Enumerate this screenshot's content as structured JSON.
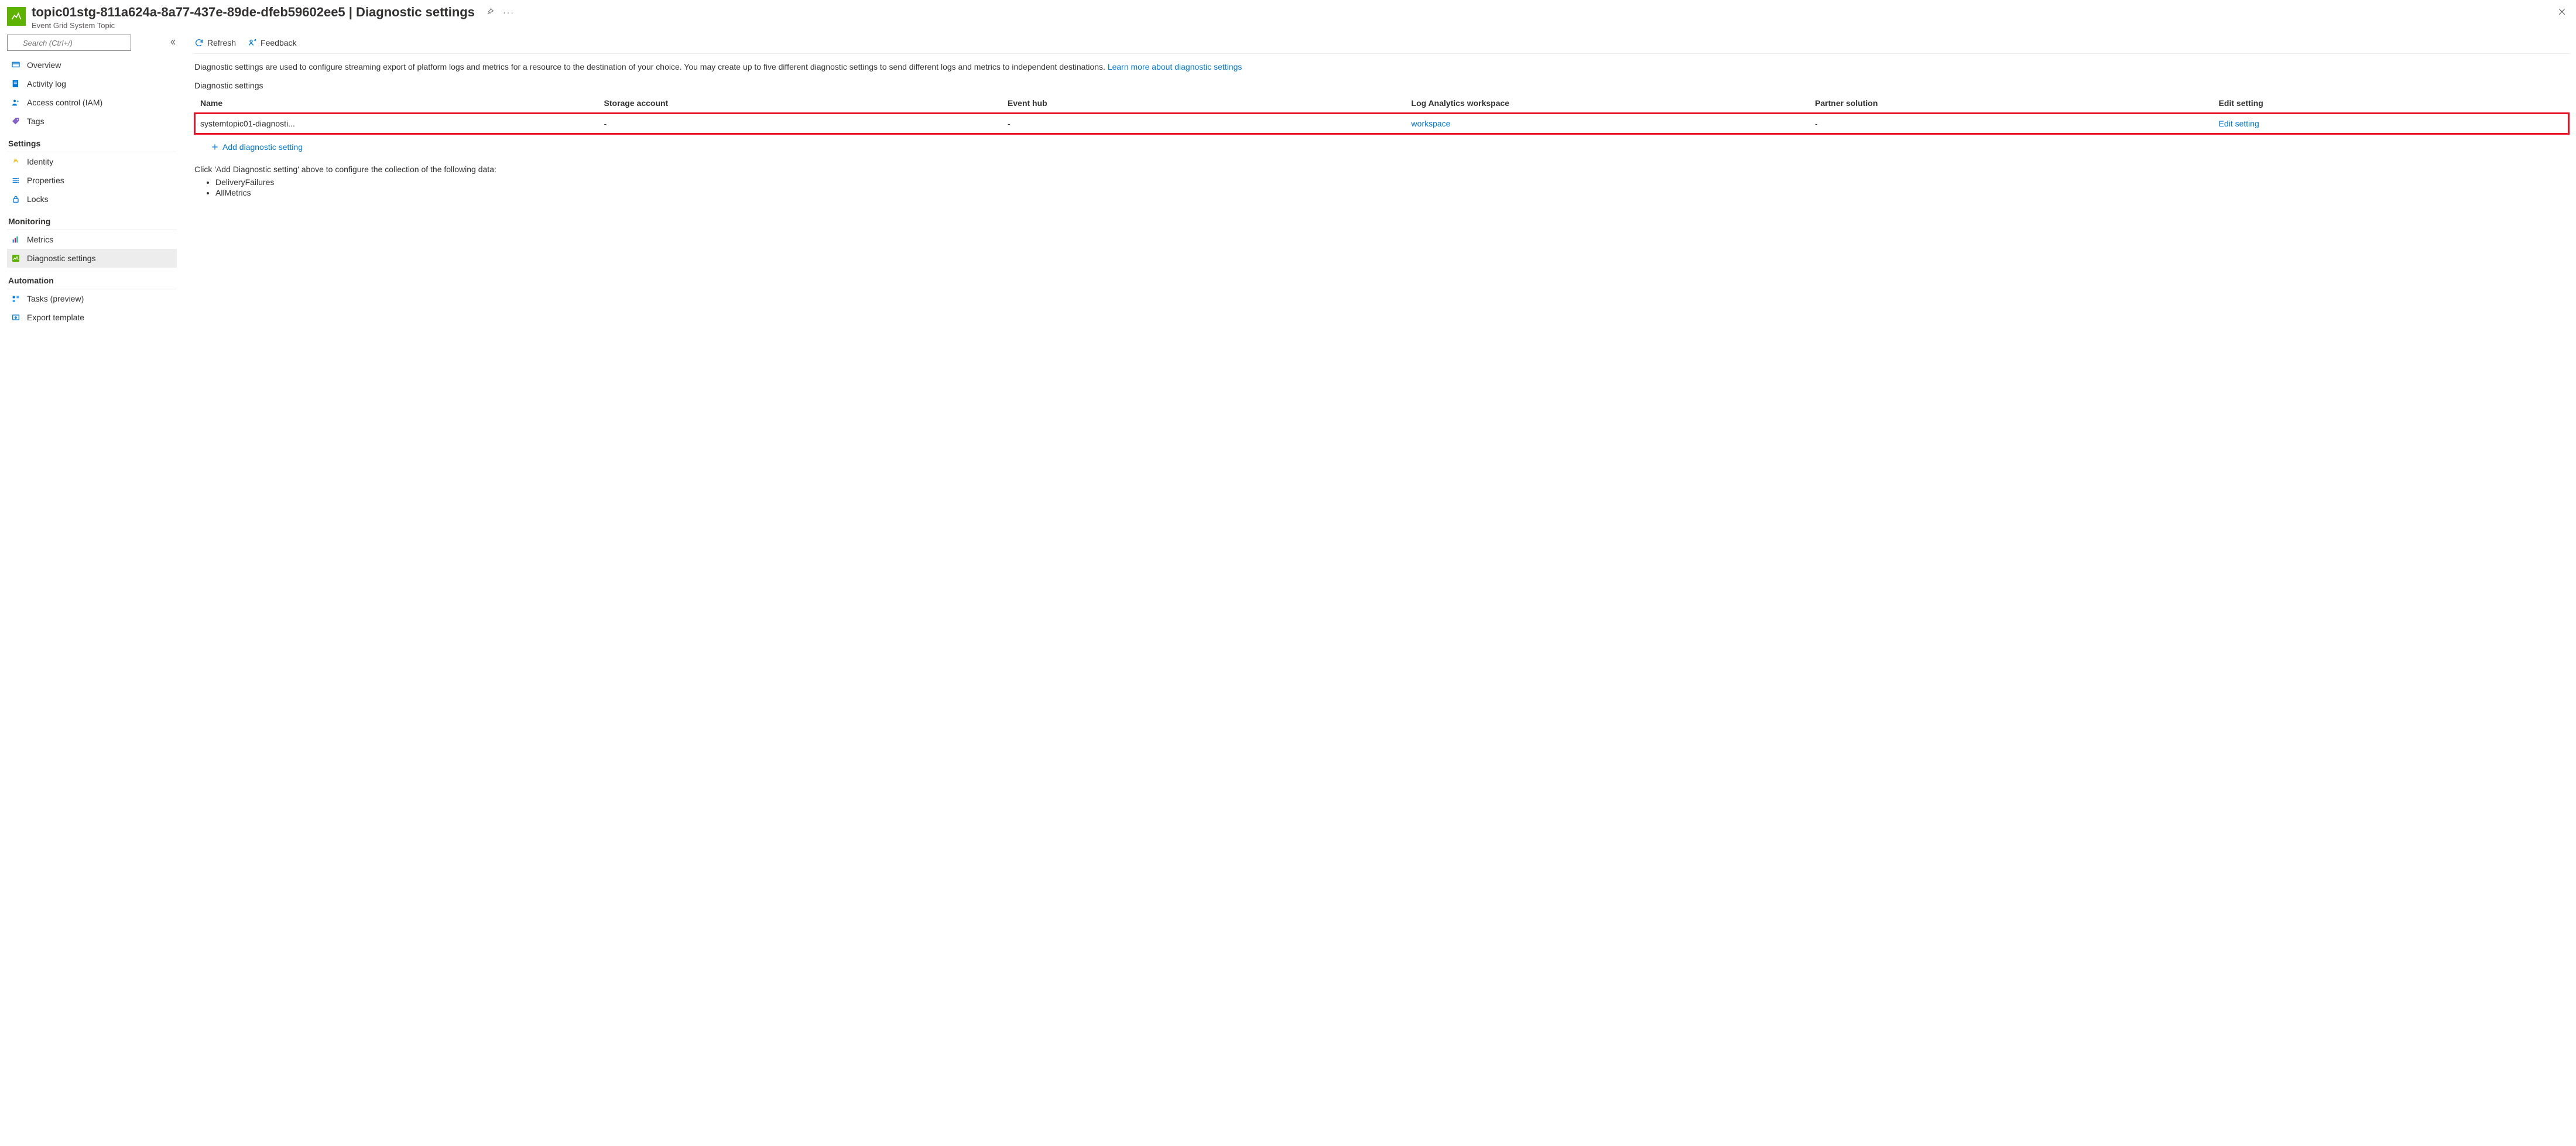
{
  "header": {
    "title": "topic01stg-811a624a-8a77-437e-89de-dfeb59602ee5 | Diagnostic settings",
    "subtitle": "Event Grid System Topic"
  },
  "sidebar": {
    "search_placeholder": "Search (Ctrl+/)",
    "top_items": [
      {
        "label": "Overview"
      },
      {
        "label": "Activity log"
      },
      {
        "label": "Access control (IAM)"
      },
      {
        "label": "Tags"
      }
    ],
    "sections": [
      {
        "heading": "Settings",
        "items": [
          {
            "label": "Identity"
          },
          {
            "label": "Properties"
          },
          {
            "label": "Locks"
          }
        ]
      },
      {
        "heading": "Monitoring",
        "items": [
          {
            "label": "Metrics"
          },
          {
            "label": "Diagnostic settings",
            "selected": true
          }
        ]
      },
      {
        "heading": "Automation",
        "items": [
          {
            "label": "Tasks (preview)"
          },
          {
            "label": "Export template"
          }
        ]
      }
    ]
  },
  "toolbar": {
    "refresh_label": "Refresh",
    "feedback_label": "Feedback"
  },
  "main": {
    "description": "Diagnostic settings are used to configure streaming export of platform logs and metrics for a resource to the destination of your choice. You may create up to five different diagnostic settings to send different logs and metrics to independent destinations. ",
    "learn_more": "Learn more about diagnostic settings",
    "section_label": "Diagnostic settings",
    "columns": {
      "name": "Name",
      "storage": "Storage account",
      "eventhub": "Event hub",
      "law": "Log Analytics workspace",
      "partner": "Partner solution",
      "edit": "Edit setting"
    },
    "row": {
      "name": "systemtopic01-diagnosti...",
      "storage": "-",
      "eventhub": "-",
      "law": "workspace",
      "partner": "-",
      "edit": "Edit setting"
    },
    "add_label": "Add diagnostic setting",
    "footer_note": "Click 'Add Diagnostic setting' above to configure the collection of the following data:",
    "footer_items": [
      "DeliveryFailures",
      "AllMetrics"
    ]
  }
}
